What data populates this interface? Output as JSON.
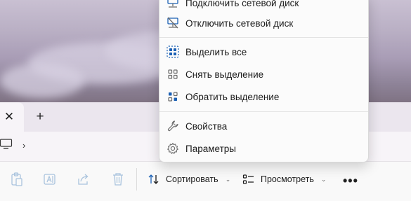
{
  "menu": {
    "items": [
      {
        "label": "Подключить сетевой диск",
        "icon": "network-drive-icon"
      },
      {
        "label": "Отключить сетевой диск",
        "icon": "disconnect-network-drive-icon"
      },
      {
        "label": "Выделить все",
        "icon": "select-all-icon"
      },
      {
        "label": "Снять выделение",
        "icon": "select-none-icon"
      },
      {
        "label": "Обратить выделение",
        "icon": "invert-selection-icon"
      },
      {
        "label": "Свойства",
        "icon": "wrench-icon"
      },
      {
        "label": "Параметры",
        "icon": "gear-icon"
      }
    ]
  },
  "tabs": {
    "close_glyph": "✕",
    "new_tab_glyph": "+"
  },
  "address": {
    "chevron": "›"
  },
  "toolbar": {
    "sort_label": "Сортировать",
    "view_label": "Просмотреть",
    "more_glyph": "•••",
    "dropdown_glyph": "⌄"
  },
  "colors": {
    "accent": "#1a5fb4",
    "icon_gray": "#6b6b6b",
    "disabled": "#a9c3dd"
  }
}
